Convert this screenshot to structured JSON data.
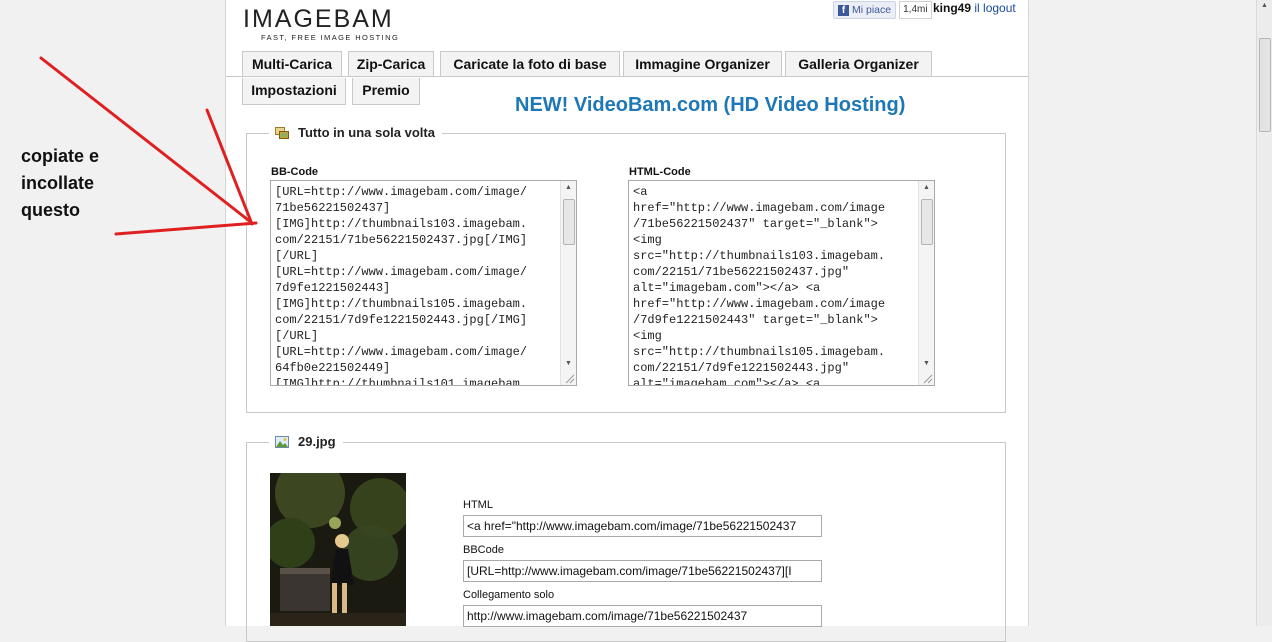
{
  "logo": {
    "name": "IMAGEBAM",
    "tagline": "FAST, FREE IMAGE HOSTING"
  },
  "facebook": {
    "like_label": "Mi piace",
    "count": "1,4mi"
  },
  "user": {
    "name": "king49",
    "logout": "il logout"
  },
  "tabs": [
    "Multi-Carica",
    "Zip-Carica",
    "Caricate la foto di base",
    "Immagine Organizer",
    "Galleria Organizer",
    "Impostazioni",
    "Premio"
  ],
  "promo": "NEW! VideoBam.com (HD Video Hosting)",
  "all_in_one": {
    "legend": "Tutto in una sola volta",
    "bbcode_label": "BB-Code",
    "bbcode_text": "[URL=http://www.imagebam.com/image/\n71be56221502437]\n[IMG]http://thumbnails103.imagebam.\ncom/22151/71be56221502437.jpg[/IMG]\n[/URL]\n[URL=http://www.imagebam.com/image/\n7d9fe1221502443]\n[IMG]http://thumbnails105.imagebam.\ncom/22151/7d9fe1221502443.jpg[/IMG]\n[/URL]\n[URL=http://www.imagebam.com/image/\n64fb0e221502449]\n[IMG]http://thumbnails101.imagebam.",
    "html_label": "HTML-Code",
    "html_text": "<a\nhref=\"http://www.imagebam.com/image\n/71be56221502437\" target=\"_blank\">\n<img\nsrc=\"http://thumbnails103.imagebam.\ncom/22151/71be56221502437.jpg\"\nalt=\"imagebam.com\"></a> <a\nhref=\"http://www.imagebam.com/image\n/7d9fe1221502443\" target=\"_blank\">\n<img\nsrc=\"http://thumbnails105.imagebam.\ncom/22151/7d9fe1221502443.jpg\"\nalt=\"imagebam.com\"></a> <a"
  },
  "image_item": {
    "legend": "29.jpg",
    "html_label": "HTML",
    "html_value": "<a href=\"http://www.imagebam.com/image/71be56221502437",
    "bbcode_label": "BBCode",
    "bbcode_value": "[URL=http://www.imagebam.com/image/71be56221502437][I",
    "link_label": "Collegamento solo",
    "link_value": "http://www.imagebam.com/image/71be56221502437"
  },
  "annotation": {
    "line1": "copiate e",
    "line2": "incollate",
    "line3": "questo"
  },
  "colors": {
    "promo": "#1e77b6",
    "arrow": "#e02020",
    "tab_bg": "#f3f3f3"
  }
}
